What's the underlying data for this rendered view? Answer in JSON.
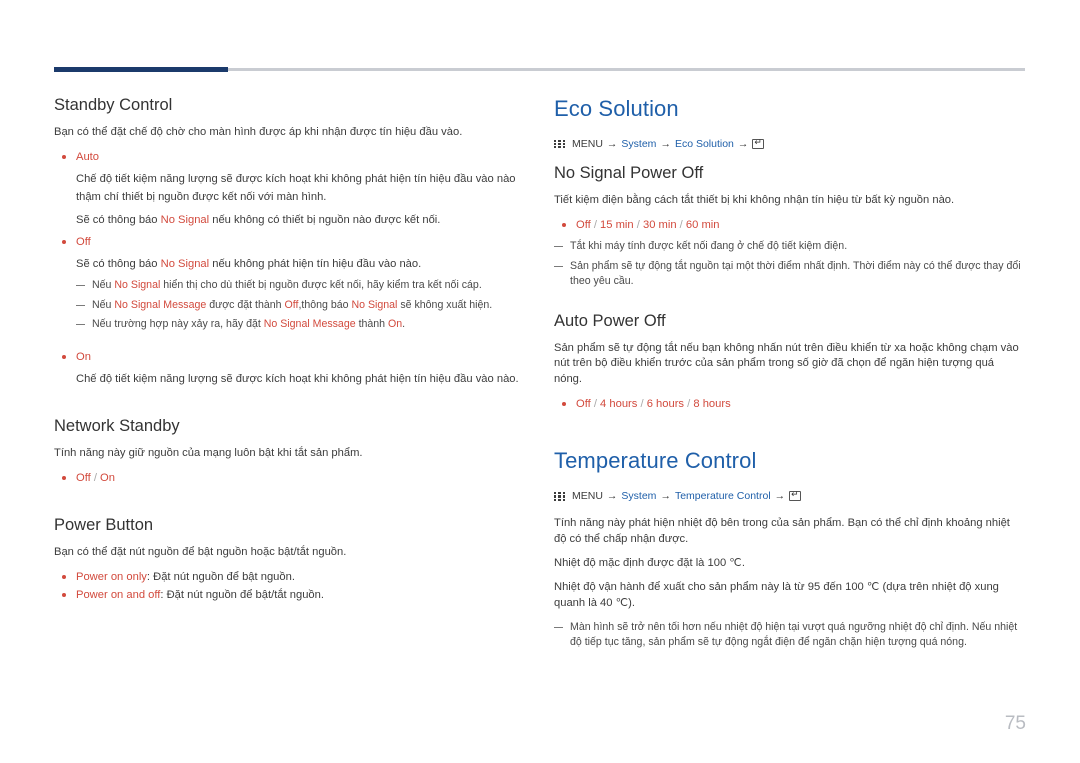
{
  "page": {
    "number": "75",
    "accent_color": "#1b3a6b",
    "heading_color": "#1f5fa9",
    "highlight_color": "#d24a3d"
  },
  "left_column": {
    "standby_control": {
      "title": "Standby Control",
      "intro": "Bạn có thể đặt chế độ chờ cho màn hình được áp khi nhận được tín hiệu đầu vào.",
      "items": [
        {
          "label": "Auto",
          "lines": [
            "Chế độ tiết kiệm năng lượng sẽ được kích hoạt khi không phát hiện tín hiệu đầu vào nào",
            "thậm chí thiết bị nguồn được kết nối với màn hình."
          ],
          "note_pre": "Sẽ có thông báo ",
          "note_red": "No Signal",
          "note_post": " nếu không có thiết bị nguồn nào được kết nối."
        },
        {
          "label": "Off",
          "note_pre": "Sẽ có thông báo ",
          "note_red": "No Signal",
          "note_post": " nếu không phát hiện tín hiệu đầu vào nào."
        },
        {
          "label": "On",
          "lines": [
            "Chế độ tiết kiệm năng lượng sẽ được kích hoạt khi không phát hiện tín hiệu đầu vào nào."
          ]
        }
      ],
      "notes": [
        {
          "segments": [
            {
              "t": "Nếu ",
              "c": "dark"
            },
            {
              "t": "No Signal",
              "c": "red"
            },
            {
              "t": " hiển thị cho dù thiết bị nguồn được kết nối, hãy kiểm tra kết nối cáp.",
              "c": "dark"
            }
          ]
        },
        {
          "segments": [
            {
              "t": "Nếu ",
              "c": "dark"
            },
            {
              "t": "No Signal Message",
              "c": "red"
            },
            {
              "t": " được đặt thành ",
              "c": "dark"
            },
            {
              "t": "Off",
              "c": "red"
            },
            {
              "t": ",thông báo ",
              "c": "dark"
            },
            {
              "t": "No Signal",
              "c": "red"
            },
            {
              "t": " sẽ không xuất hiện.",
              "c": "dark"
            }
          ]
        },
        {
          "segments": [
            {
              "t": "Nếu trường hợp này xảy ra, hãy đặt ",
              "c": "dark"
            },
            {
              "t": "No Signal Message",
              "c": "red"
            },
            {
              "t": " thành ",
              "c": "dark"
            },
            {
              "t": "On",
              "c": "red"
            },
            {
              "t": ".",
              "c": "dark"
            }
          ]
        }
      ]
    },
    "network_standby": {
      "title": "Network Standby",
      "intro": "Tính năng này giữ nguồn của mạng luôn bật khi tắt sản phẩm.",
      "options": [
        "Off",
        "On"
      ]
    },
    "power_button": {
      "title": "Power Button",
      "intro": "Bạn có thể đặt nút nguồn để bật nguồn hoặc bật/tắt nguồn.",
      "items": [
        {
          "label": "Power on only",
          "desc": ": Đặt nút nguồn để bật nguồn."
        },
        {
          "label": "Power on and off",
          "desc": ": Đặt nút nguồn để bật/tắt nguồn."
        }
      ]
    }
  },
  "right_column": {
    "eco_solution": {
      "title": "Eco Solution",
      "menu_path": {
        "menu": "MENU",
        "level1": "System",
        "level2": "Eco Solution",
        "arrow": "→"
      },
      "no_signal_power_off": {
        "title": "No Signal Power Off",
        "intro": "Tiết kiệm điện bằng cách tắt thiết bị khi không nhận tín hiệu từ bất kỳ nguồn nào.",
        "options": [
          "Off",
          "15 min",
          "30 min",
          "60 min"
        ],
        "notes": [
          "Tắt khi máy tính được kết nối đang ở chế độ tiết kiệm điện.",
          "Sản phẩm sẽ tự động tắt nguồn tại một thời điểm nhất định. Thời điểm này có thể được thay đổi theo yêu cầu."
        ]
      },
      "auto_power_off": {
        "title": "Auto Power Off",
        "intro": "Sản phẩm sẽ tự động tắt nếu bạn không nhấn nút trên điều khiển từ xa hoặc không chạm vào nút trên bộ điều khiển trước của sản phẩm trong số giờ đã chọn để ngăn hiện tượng quá nóng.",
        "options": [
          "Off",
          "4 hours",
          "6 hours",
          "8 hours"
        ]
      }
    },
    "temperature_control": {
      "title": "Temperature Control",
      "menu_path": {
        "menu": "MENU",
        "level1": "System",
        "level2": "Temperature Control",
        "arrow": "→"
      },
      "paragraphs": [
        "Tính năng này phát hiện nhiệt độ bên trong của sản phẩm. Bạn có thể chỉ định khoảng nhiệt độ có thể chấp nhận được.",
        "Nhiệt độ mặc định được đặt là 100 ℃.",
        "Nhiệt độ vận hành để xuất cho sản phẩm này là từ 95 đến 100 ℃ (dựa trên nhiệt độ xung quanh là 40 ℃)."
      ],
      "note": "Màn hình sẽ trở nên tối hơn nếu nhiệt độ hiện tại vượt quá ngưỡng nhiệt độ chỉ định. Nếu nhiệt độ tiếp tục tăng, sản phẩm sẽ tự động ngắt điện để ngăn chặn hiện tượng quá nóng."
    }
  }
}
